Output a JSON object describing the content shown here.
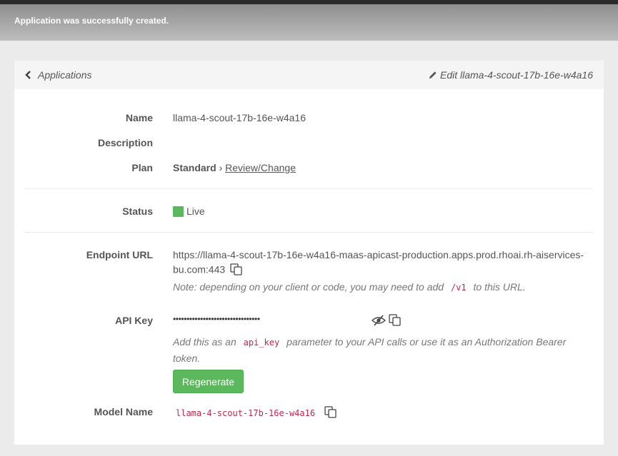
{
  "flash": {
    "message": "Application was successfully created."
  },
  "header": {
    "back_label": "Applications",
    "edit_label": "Edit llama-4-scout-17b-16e-w4a16"
  },
  "fields": {
    "name_label": "Name",
    "name_value": "llama-4-scout-17b-16e-w4a16",
    "description_label": "Description",
    "plan_label": "Plan",
    "plan_value": "Standard",
    "plan_sep": "›",
    "plan_link": "Review/Change",
    "status_label": "Status",
    "status_value": "Live",
    "status_color": "#5bb85d",
    "endpoint_label": "Endpoint URL",
    "endpoint_line1": "https://llama-4-scout-17b-16e-w4a16-maas-apicast-production.apps.prod.rhoai.rh-aiservices-",
    "endpoint_line2": "bu.com:443",
    "endpoint_note_pre": "Note: depending on your client or code, you may need to add",
    "endpoint_note_code": "/v1",
    "endpoint_note_post": "to this URL.",
    "apikey_label": "API Key",
    "apikey_masked": "••••••••••••••••••••••••••••••••",
    "apikey_note_pre": "Add this as an",
    "apikey_note_code": "api_key",
    "apikey_note_post": "parameter to your API calls or use it as an Authorization Bearer",
    "apikey_note_line2": "token.",
    "regenerate_label": "Regenerate",
    "model_label": "Model Name",
    "model_value": "llama-4-scout-17b-16e-w4a16"
  },
  "icons": {
    "back": "chevron-left-icon",
    "edit": "pencil-icon",
    "copy": "copy-icon",
    "reveal": "eye-slash-icon"
  }
}
